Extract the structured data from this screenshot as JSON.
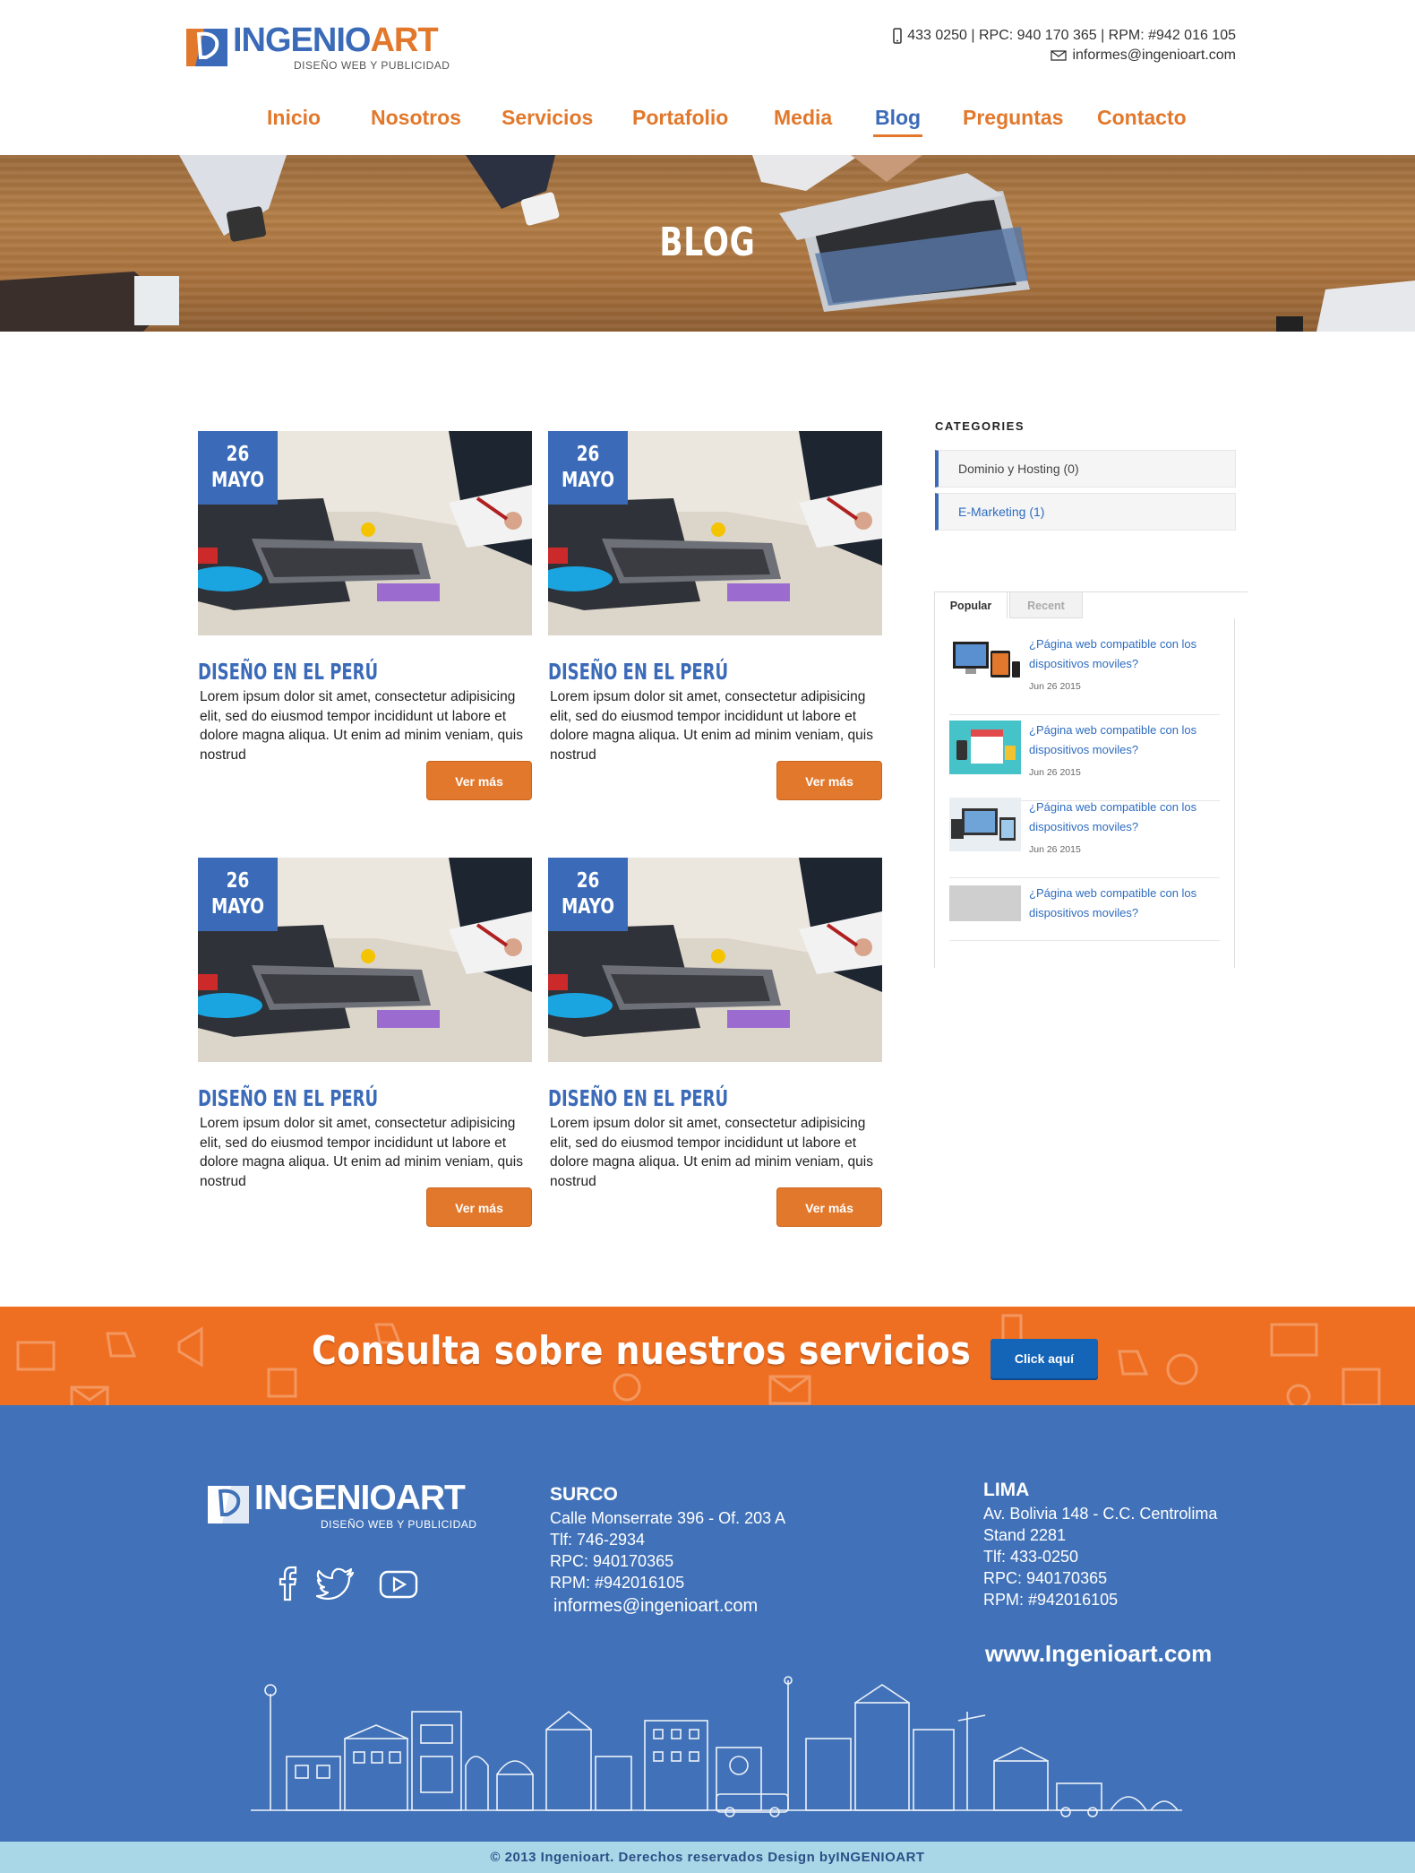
{
  "brand": {
    "name_part1": "INGENIO",
    "name_part2": "ART",
    "tagline": "DISEÑO WEB Y PUBLICIDAD",
    "blue": "#3b6bb8",
    "orange": "#e2782b"
  },
  "header": {
    "phone_line": "433 0250 | RPC: 940 170 365 | RPM: #942 016 105",
    "email": "informes@ingenioart.com",
    "phone_icon": "mobile-phone-icon",
    "email_icon": "envelope-icon"
  },
  "nav": {
    "items": [
      {
        "label": "Inicio"
      },
      {
        "label": "Nosotros"
      },
      {
        "label": "Servicios"
      },
      {
        "label": "Portafolio"
      },
      {
        "label": "Media"
      },
      {
        "label": "Blog",
        "active": true
      },
      {
        "label": "Preguntas"
      },
      {
        "label": "Contacto"
      }
    ]
  },
  "hero": {
    "title": "BLOG"
  },
  "posts": [
    {
      "day": "26",
      "month": "MAYO",
      "title": "DISEÑO EN EL PERÚ",
      "excerpt": "Lorem ipsum dolor sit amet, consectetur adipisicing elit, sed do eiusmod tempor incididunt ut labore et dolore magna aliqua. Ut enim ad minim veniam, quis nostrud",
      "button": "Ver más"
    },
    {
      "day": "26",
      "month": "MAYO",
      "title": "DISEÑO EN EL PERÚ",
      "excerpt": "Lorem ipsum dolor sit amet, consectetur adipisicing elit, sed do eiusmod tempor incididunt ut labore et dolore magna aliqua. Ut enim ad minim veniam, quis nostrud",
      "button": "Ver más"
    },
    {
      "day": "26",
      "month": "MAYO",
      "title": "DISEÑO EN EL PERÚ",
      "excerpt": "Lorem ipsum dolor sit amet, consectetur adipisicing elit, sed do eiusmod tempor incididunt ut labore et dolore magna aliqua. Ut enim ad minim veniam, quis nostrud",
      "button": "Ver más"
    },
    {
      "day": "26",
      "month": "MAYO",
      "title": "DISEÑO EN EL PERÚ",
      "excerpt": "Lorem ipsum dolor sit amet, consectetur adipisicing elit, sed do eiusmod tempor incididunt ut labore et dolore magna aliqua. Ut enim ad minim veniam, quis nostrud",
      "button": "Ver más"
    }
  ],
  "sidebar": {
    "categories_title": "CATEGORIES",
    "categories": [
      {
        "label": "Dominio y Hosting (0)"
      },
      {
        "label": "E-Marketing (1)"
      }
    ],
    "tabs": [
      {
        "label": "Popular",
        "active": true
      },
      {
        "label": "Recent"
      }
    ],
    "popular": [
      {
        "title": "¿Página web compatible con los dispositivos moviles?",
        "date": "Jun 26 2015"
      },
      {
        "title": "¿Página web compatible con los dispositivos moviles?",
        "date": "Jun 26 2015"
      },
      {
        "title": "¿Página web compatible con los dispositivos moviles?",
        "date": "Jun 26 2015"
      },
      {
        "title": "¿Página web compatible con los dispositivos moviles?",
        "date": ""
      }
    ]
  },
  "cta": {
    "text": "Consulta sobre nuestros servicios",
    "button": "Click aquí"
  },
  "footer": {
    "surco": {
      "heading": "SURCO",
      "address": "Calle Monserrate 396 - Of. 203 A",
      "tlf": "Tlf: 746-2934",
      "rpc": "RPC: 940170365",
      "rpm": "RPM: #942016105",
      "email": "informes@ingenioart.com"
    },
    "lima": {
      "heading": "LIMA",
      "address1": "Av. Bolivia 148 - C.C. Centrolima",
      "address2": "Stand 2281",
      "tlf": "Tlf: 433-0250",
      "rpc": "RPC: 940170365",
      "rpm": "RPM: #942016105"
    },
    "website": "www.Ingenioart.com",
    "social": [
      "facebook-icon",
      "twitter-icon",
      "youtube-icon"
    ],
    "copyright": "© 2013 Ingenioart. Derechos reservados Design byINGENIOART"
  }
}
